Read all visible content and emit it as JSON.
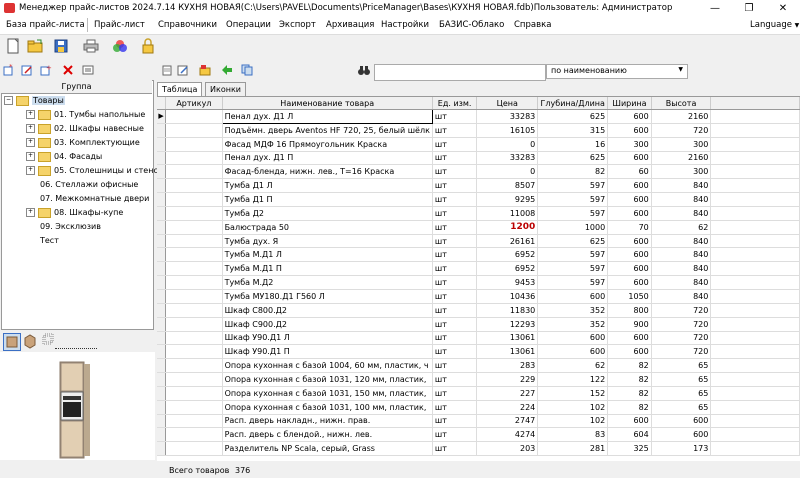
{
  "window": {
    "title": "Менеджер прайс-листов 2024.7.14   КУХНЯ НОВАЯ(C:\\Users\\PAVEL\\Documents\\PriceManager\\Bases\\КУХНЯ НОВАЯ.fdb)Пользователь: Администратор",
    "buttons": [
      "—",
      "❐",
      "✕"
    ]
  },
  "menu": {
    "items": [
      "База прайс-листа",
      "Прайс-лист",
      "Справочники",
      "Операции",
      "Экспорт",
      "Архивация",
      "Настройки",
      "БАЗИС-Облако",
      "Справка"
    ],
    "language": "Language"
  },
  "search": {
    "value": "",
    "sort_by": "по наименованию"
  },
  "tree": {
    "header": "Группа",
    "root": "Товары",
    "items": [
      {
        "label": "01. Тумбы напольные",
        "folder": true,
        "expandable": true
      },
      {
        "label": "02. Шкафы навесные",
        "folder": true,
        "expandable": true
      },
      {
        "label": "03. Комплектующие",
        "folder": true,
        "expandable": true
      },
      {
        "label": "04. Фасады",
        "folder": true,
        "expandable": true
      },
      {
        "label": "05. Столешницы и стенс",
        "folder": true,
        "expandable": true
      },
      {
        "label": "06. Стеллажи офисные",
        "folder": false,
        "expandable": false
      },
      {
        "label": "07. Межкомнатные двери",
        "folder": false,
        "expandable": false
      },
      {
        "label": "08. Шкафы-купе",
        "folder": true,
        "expandable": true
      },
      {
        "label": "09. Эксклюзив",
        "folder": false,
        "expandable": false
      },
      {
        "label": "Тест",
        "folder": false,
        "expandable": false
      }
    ]
  },
  "tabs": [
    "Таблица",
    "Иконки"
  ],
  "table": {
    "columns": [
      "Артикул",
      "Наименование товара",
      "Ед. изм.",
      "Цена",
      "Глубина/Длина",
      "Ширина",
      "Высота"
    ],
    "rows": [
      [
        "",
        "Пенал дух. Д1 Л",
        "шт",
        "33283",
        "625",
        "600",
        "2160"
      ],
      [
        "",
        "Подъёмн. дверь Aventos HF 720, 25, белый шёлк",
        "шт",
        "16105",
        "315",
        "600",
        "720"
      ],
      [
        "",
        "Фасад МДФ 16 Прямоугольник Краска",
        "шт",
        "0",
        "16",
        "300",
        "300"
      ],
      [
        "",
        "Пенал дух. Д1 П",
        "шт",
        "33283",
        "625",
        "600",
        "2160"
      ],
      [
        "",
        "Фасад-бленда, нижн. лев., Т=16 Краска",
        "шт",
        "0",
        "82",
        "60",
        "300"
      ],
      [
        "",
        "Тумба Д1 Л",
        "шт",
        "8507",
        "597",
        "600",
        "840"
      ],
      [
        "",
        "Тумба Д1 П",
        "шт",
        "9295",
        "597",
        "600",
        "840"
      ],
      [
        "",
        "Тумба Д2",
        "шт",
        "11008",
        "597",
        "600",
        "840"
      ],
      [
        "",
        "Балюстрада 50",
        "шт",
        "1200",
        "1000",
        "70",
        "62"
      ],
      [
        "",
        "Тумба дух. Я",
        "шт",
        "26161",
        "625",
        "600",
        "840"
      ],
      [
        "",
        "Тумба М.Д1 Л",
        "шт",
        "6952",
        "597",
        "600",
        "840"
      ],
      [
        "",
        "Тумба М.Д1 П",
        "шт",
        "6952",
        "597",
        "600",
        "840"
      ],
      [
        "",
        "Тумба М.Д2",
        "шт",
        "9453",
        "597",
        "600",
        "840"
      ],
      [
        "",
        "Тумба МУ180.Д1 Г560 Л",
        "шт",
        "10436",
        "600",
        "1050",
        "840"
      ],
      [
        "",
        "Шкаф С800.Д2",
        "шт",
        "11830",
        "352",
        "800",
        "720"
      ],
      [
        "",
        "Шкаф С900.Д2",
        "шт",
        "12293",
        "352",
        "900",
        "720"
      ],
      [
        "",
        "Шкаф У90.Д1 Л",
        "шт",
        "13061",
        "600",
        "600",
        "720"
      ],
      [
        "",
        "Шкаф У90.Д1 П",
        "шт",
        "13061",
        "600",
        "600",
        "720"
      ],
      [
        "",
        "Опора кухонная с базой 1004, 60 мм, пластик, ч",
        "шт",
        "283",
        "62",
        "82",
        "65"
      ],
      [
        "",
        "Опора кухонная с базой 1031, 120 мм, пластик,",
        "шт",
        "229",
        "122",
        "82",
        "65"
      ],
      [
        "",
        "Опора кухонная с базой 1031, 150 мм, пластик,",
        "шт",
        "227",
        "152",
        "82",
        "65"
      ],
      [
        "",
        "Опора кухонная с базой 1031, 100 мм, пластик,",
        "шт",
        "224",
        "102",
        "82",
        "65"
      ],
      [
        "",
        "Расп. дверь накладн., нижн. прав.",
        "шт",
        "2747",
        "102",
        "600",
        "600"
      ],
      [
        "",
        "Расп. дверь с блендой., нижн. лев.",
        "шт",
        "4274",
        "83",
        "604",
        "600"
      ],
      [
        "",
        "Разделитель NP Scala, серый, Grass",
        "шт",
        "203",
        "281",
        "325",
        "173"
      ]
    ],
    "selected_row": 0,
    "highlight_row": 8
  },
  "status": {
    "label": "Всего товаров",
    "count": "376"
  },
  "colors": {
    "folder": "#f5d36a",
    "highlight_price": "#bb0000",
    "app_icon": "#dd3333"
  }
}
